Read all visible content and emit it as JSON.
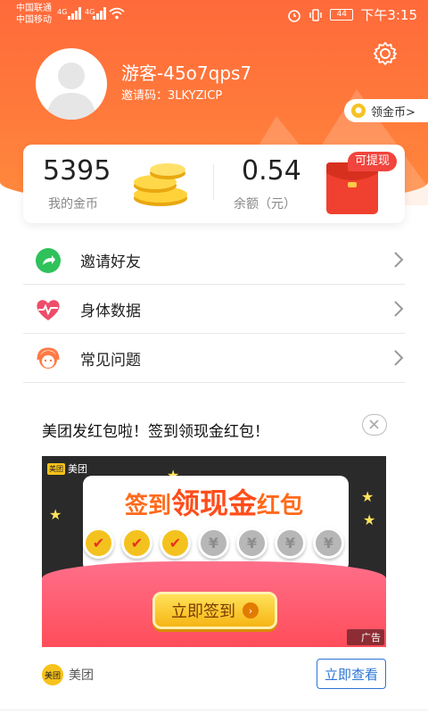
{
  "status_bar": {
    "carrier1": "中国联通",
    "carrier2": "中国移动",
    "net1": "4G",
    "net2": "4G",
    "battery": "44",
    "time": "下午3:15"
  },
  "profile": {
    "username": "游客-45o7qps7",
    "invite_code": "邀请码：3LKYZICP",
    "coin_link": "领金币>"
  },
  "stats": {
    "coins_value": "5395",
    "coins_label": "我的金币",
    "balance_value": "0.54",
    "balance_label": "余额（元）",
    "withdraw_badge": "可提现"
  },
  "menu": {
    "items": [
      {
        "label": "邀请好友",
        "icon": "share-icon"
      },
      {
        "label": "身体数据",
        "icon": "heart-pulse-icon"
      },
      {
        "label": "常见问题",
        "icon": "customer-service-icon"
      }
    ]
  },
  "ad": {
    "title": "美团发红包啦！签到领现金红包！",
    "brand": "美团",
    "brand_short": "美团",
    "headline_pre": "签到",
    "headline_big": "领现金",
    "headline_post": "红包",
    "coin_check": "✔",
    "coin_yen": "¥",
    "sign_button": "立即签到",
    "ad_tag": "广告",
    "footer_brand": "美团",
    "view_button": "立即查看"
  },
  "colors": {
    "accent_orange": "#ff6a3b",
    "badge_red": "#f1453d",
    "link_blue": "#2a74d6"
  }
}
